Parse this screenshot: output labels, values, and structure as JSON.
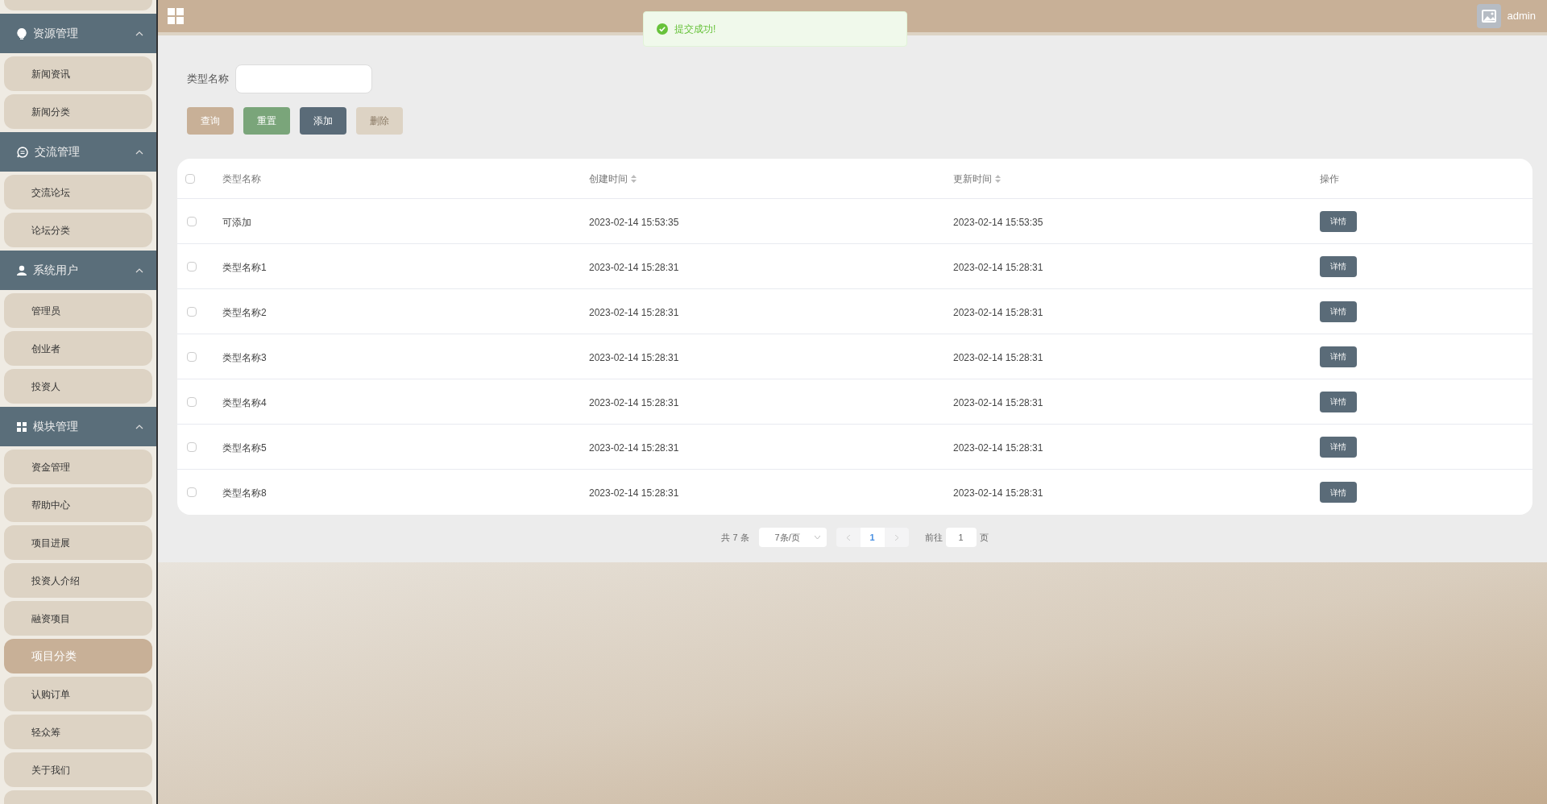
{
  "header": {
    "user": "admin"
  },
  "toast": {
    "kind": "success",
    "message": "提交成功!"
  },
  "sidebar": {
    "groups": [
      {
        "title": "资源管理",
        "expanded": true,
        "items": [
          {
            "label": "新闻资讯",
            "selected": false
          },
          {
            "label": "新闻分类",
            "selected": false
          }
        ]
      },
      {
        "title": "交流管理",
        "expanded": true,
        "items": [
          {
            "label": "交流论坛",
            "selected": false
          },
          {
            "label": "论坛分类",
            "selected": false
          }
        ]
      },
      {
        "title": "系统用户",
        "expanded": true,
        "items": [
          {
            "label": "管理员",
            "selected": false
          },
          {
            "label": "创业者",
            "selected": false
          },
          {
            "label": "投资人",
            "selected": false
          }
        ]
      },
      {
        "title": "模块管理",
        "expanded": true,
        "items": [
          {
            "label": "资金管理",
            "selected": false
          },
          {
            "label": "帮助中心",
            "selected": false
          },
          {
            "label": "项目进展",
            "selected": false
          },
          {
            "label": "投资人介绍",
            "selected": false
          },
          {
            "label": "融资项目",
            "selected": false
          },
          {
            "label": "项目分类",
            "selected": true
          },
          {
            "label": "认购订单",
            "selected": false
          },
          {
            "label": "轻众筹",
            "selected": false
          },
          {
            "label": "关于我们",
            "selected": false
          }
        ]
      }
    ]
  },
  "search": {
    "label": "类型名称"
  },
  "buttons": [
    {
      "label": "查询",
      "kind": "query",
      "disabled": false
    },
    {
      "label": "重置",
      "kind": "reset",
      "disabled": false
    },
    {
      "label": "添加",
      "kind": "add",
      "disabled": false
    },
    {
      "label": "删除",
      "kind": "delete",
      "disabled": true
    }
  ],
  "table": {
    "all_checked": false,
    "columns": [
      {
        "label": "类型名称",
        "sortable": false
      },
      {
        "label": "创建时间",
        "sortable": true
      },
      {
        "label": "更新时间",
        "sortable": true
      },
      {
        "label": "操作",
        "sortable": false
      }
    ],
    "rows": [
      {
        "checked": false,
        "name": "可添加",
        "created": "2023-02-14 15:53:35",
        "updated": "2023-02-14 15:53:35",
        "action": "详情"
      },
      {
        "checked": false,
        "name": "类型名称1",
        "created": "2023-02-14 15:28:31",
        "updated": "2023-02-14 15:28:31",
        "action": "详情"
      },
      {
        "checked": false,
        "name": "类型名称2",
        "created": "2023-02-14 15:28:31",
        "updated": "2023-02-14 15:28:31",
        "action": "详情"
      },
      {
        "checked": false,
        "name": "类型名称3",
        "created": "2023-02-14 15:28:31",
        "updated": "2023-02-14 15:28:31",
        "action": "详情"
      },
      {
        "checked": false,
        "name": "类型名称4",
        "created": "2023-02-14 15:28:31",
        "updated": "2023-02-14 15:28:31",
        "action": "详情"
      },
      {
        "checked": false,
        "name": "类型名称5",
        "created": "2023-02-14 15:28:31",
        "updated": "2023-02-14 15:28:31",
        "action": "详情"
      },
      {
        "checked": false,
        "name": "类型名称8",
        "created": "2023-02-14 15:28:31",
        "updated": "2023-02-14 15:28:31",
        "action": "详情"
      }
    ]
  },
  "pagination": {
    "total": "共 7 条",
    "page_size": "7条/页",
    "pages": [
      {
        "label": "1",
        "selected": true
      }
    ],
    "goto_label": "前往",
    "goto_value": "1",
    "page_unit": "页"
  }
}
